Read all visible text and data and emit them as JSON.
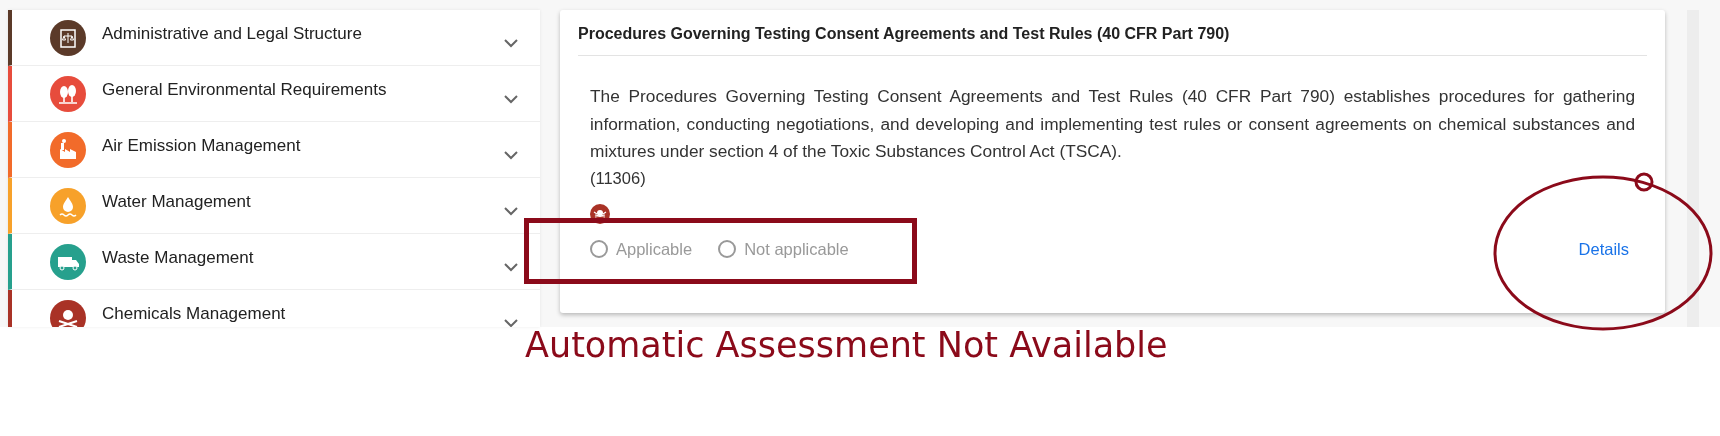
{
  "sidebar": {
    "items": [
      {
        "label": "Administrative and Legal Structure",
        "color": "#5b3a29",
        "expanded": false
      },
      {
        "label": "General Environmental Requirements",
        "color": "#e74c3c",
        "expanded": false
      },
      {
        "label": "Air Emission Management",
        "color": "#f26b2a",
        "expanded": false
      },
      {
        "label": "Water Management",
        "color": "#f7a12a",
        "expanded": false
      },
      {
        "label": "Waste Management",
        "color": "#26a08d",
        "expanded": false
      },
      {
        "label": "Chemicals Management",
        "color": "#a93226",
        "expanded": false
      }
    ]
  },
  "card": {
    "title": "Procedures Governing Testing Consent Agreements and Test Rules (40 CFR Part 790)",
    "description": "The Procedures Governing Testing Consent Agreements and Test Rules (40 CFR Part 790) establishes procedures for gathering information, conducting negotiations, and developing and implementing test rules or consent agreements on chemical substances and mixtures under section 4 of the Toxic Substances Control Act (TSCA).",
    "code": "(11306)",
    "options": [
      {
        "label": "Applicable",
        "selected": false,
        "disabled": true
      },
      {
        "label": "Not applicable",
        "selected": false,
        "disabled": true
      }
    ],
    "details_link": "Details"
  },
  "annotation": {
    "note": "Automatic Assessment Not Available"
  }
}
